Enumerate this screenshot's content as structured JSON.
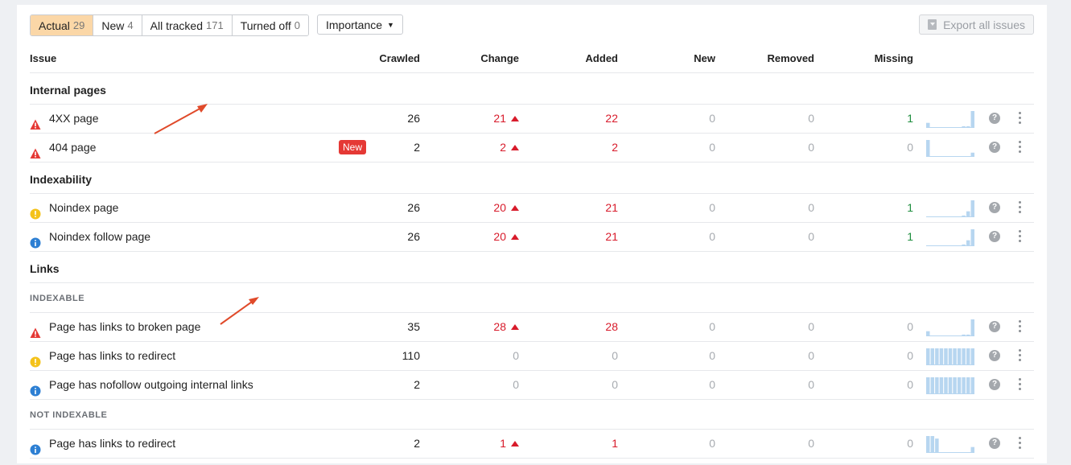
{
  "tabs": [
    {
      "label": "Actual",
      "count": "29",
      "active": true
    },
    {
      "label": "New",
      "count": "4",
      "active": false
    },
    {
      "label": "All tracked",
      "count": "171",
      "active": false
    },
    {
      "label": "Turned off",
      "count": "0",
      "active": false
    }
  ],
  "importance_label": "Importance",
  "export_label": "Export all issues",
  "columns": {
    "issue": "Issue",
    "crawled": "Crawled",
    "change": "Change",
    "added": "Added",
    "new": "New",
    "removed": "Removed",
    "missing": "Missing"
  },
  "groups": {
    "internal": "Internal pages",
    "indexability": "Indexability",
    "links": "Links",
    "links_indexable": "INDEXABLE",
    "links_not_indexable": "NOT INDEXABLE"
  },
  "badge_new": "New",
  "help_glyph": "?",
  "rows": [
    {
      "name": "4XX page",
      "icon": "error-icon",
      "crawled": "26",
      "change": "21",
      "change_up": true,
      "added": "22",
      "new": "0",
      "removed": "0",
      "missing": "1",
      "spark": [
        0.3,
        0,
        0,
        0,
        0,
        0,
        0,
        0,
        0.1,
        0.1,
        1.0
      ]
    },
    {
      "name": "404 page",
      "icon": "error-icon",
      "is_new": true,
      "crawled": "2",
      "change": "2",
      "change_up": true,
      "added": "2",
      "new": "0",
      "removed": "0",
      "missing": "0",
      "spark": [
        1.0,
        0,
        0,
        0,
        0,
        0,
        0,
        0,
        0,
        0,
        0.25
      ]
    },
    {
      "name": "Noindex page",
      "icon": "warning-icon",
      "crawled": "26",
      "change": "20",
      "change_up": true,
      "added": "21",
      "new": "0",
      "removed": "0",
      "missing": "1",
      "spark": [
        0,
        0,
        0,
        0,
        0,
        0,
        0,
        0,
        0.1,
        0.35,
        1.0
      ]
    },
    {
      "name": "Noindex follow page",
      "icon": "info-icon",
      "crawled": "26",
      "change": "20",
      "change_up": true,
      "added": "21",
      "new": "0",
      "removed": "0",
      "missing": "1",
      "spark": [
        0,
        0,
        0,
        0,
        0,
        0,
        0,
        0,
        0.1,
        0.35,
        1.0
      ]
    },
    {
      "name": "Page has links to broken page",
      "icon": "error-icon",
      "crawled": "35",
      "change": "28",
      "change_up": true,
      "added": "28",
      "new": "0",
      "removed": "0",
      "missing": "0",
      "spark": [
        0.3,
        0,
        0,
        0,
        0,
        0,
        0,
        0,
        0.1,
        0.1,
        1.0
      ]
    },
    {
      "name": "Page has links to redirect",
      "icon": "warning-icon",
      "crawled": "110",
      "change": "0",
      "change_up": false,
      "added": "0",
      "new": "0",
      "removed": "0",
      "missing": "0",
      "spark": [
        1,
        1,
        1,
        1,
        1,
        1,
        1,
        1,
        1,
        1,
        1
      ]
    },
    {
      "name": "Page has nofollow outgoing internal links",
      "icon": "info-icon",
      "crawled": "2",
      "change": "0",
      "change_up": false,
      "added": "0",
      "new": "0",
      "removed": "0",
      "missing": "0",
      "spark": [
        1,
        1,
        1,
        1,
        1,
        1,
        1,
        1,
        1,
        1,
        1
      ]
    },
    {
      "name": "Page has links to redirect",
      "icon": "info-icon",
      "crawled": "2",
      "change": "1",
      "change_up": true,
      "added": "1",
      "new": "0",
      "removed": "0",
      "missing": "0",
      "spark": [
        1.0,
        1.0,
        0.85,
        0,
        0,
        0,
        0,
        0,
        0,
        0,
        0.35
      ]
    }
  ],
  "colors": {
    "error": "#e53935",
    "warning": "#f4c21a",
    "info": "#2d7fd3",
    "spark": "#b7d6f0",
    "active_tab": "#fbd7a7"
  }
}
